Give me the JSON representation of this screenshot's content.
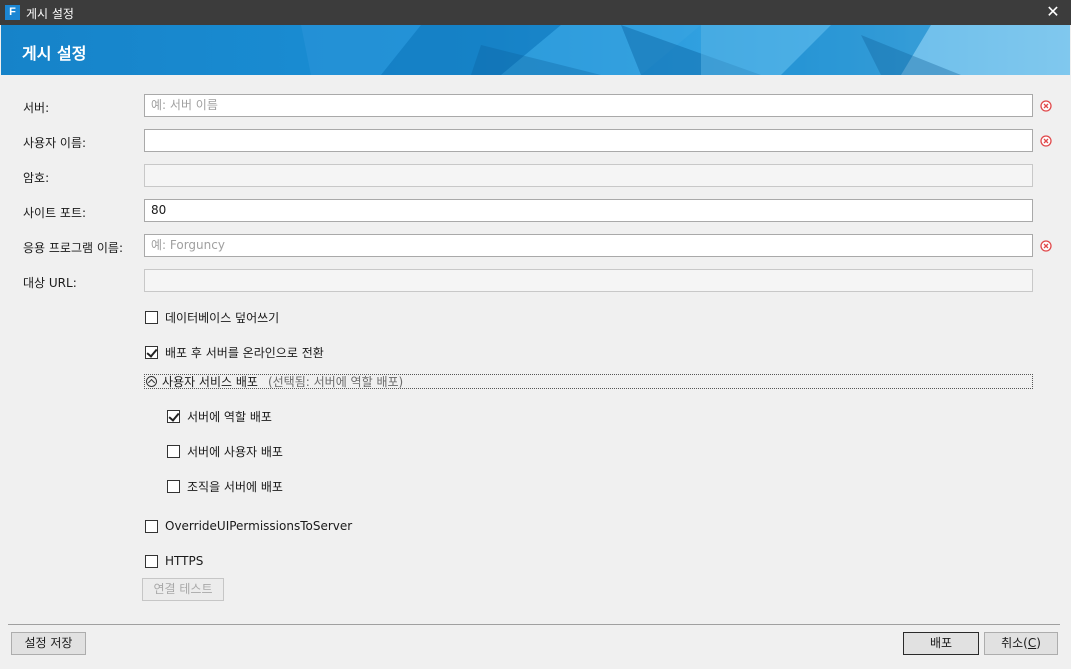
{
  "window": {
    "app_icon_letter": "F",
    "title": "게시 설정",
    "close_glyph": "✕"
  },
  "header": {
    "title": "게시 설정"
  },
  "form": {
    "server": {
      "label": "서버:",
      "value": "",
      "placeholder": "예: 서버 이름"
    },
    "username": {
      "label": "사용자 이름:",
      "value": ""
    },
    "password": {
      "label": "암호:",
      "value": ""
    },
    "site_port": {
      "label": "사이트 포트:",
      "value": "80"
    },
    "app_name": {
      "label": "응용 프로그램 이름:",
      "value": "",
      "placeholder": "예: Forguncy"
    },
    "target_url": {
      "label": "대상 URL:",
      "value": ""
    }
  },
  "options": {
    "overwrite_db": {
      "label": "데이터베이스 덮어쓰기",
      "checked": false
    },
    "online_after": {
      "label": "배포 후 서버를 온라인으로 전환",
      "checked": true
    },
    "user_service": {
      "label": "사용자 서비스 배포",
      "note": "(선택됨: 서버에 역할 배포)",
      "items": [
        {
          "label": "서버에 역할 배포",
          "checked": true
        },
        {
          "label": "서버에 사용자 배포",
          "checked": false
        },
        {
          "label": "조직을 서버에 배포",
          "checked": false
        }
      ]
    },
    "override_ui": {
      "label": "OverrideUIPermissionsToServer",
      "checked": false
    },
    "https": {
      "label": "HTTPS",
      "checked": false
    }
  },
  "buttons": {
    "test_connection": "연결 테스트",
    "save_settings": "설정 저장",
    "deploy": "배포",
    "cancel_text": "취소(",
    "cancel_key": "C",
    "cancel_end": ")"
  },
  "colors": {
    "error_icon": "#e0494b",
    "header_blue": "#1b90d6"
  }
}
